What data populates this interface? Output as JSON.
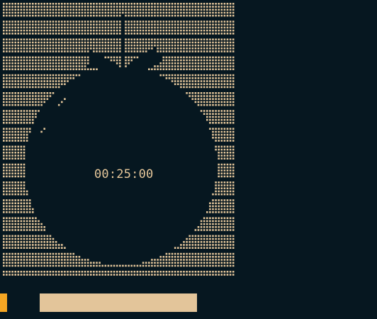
{
  "timer": {
    "remaining": "00:25:00",
    "progress_fraction": 1.0
  },
  "art": {
    "name": "tomato-icon"
  },
  "colors": {
    "background": "#061720",
    "dots": "#e3c59a",
    "timer_text": "#e6c79a",
    "status_indicator": "#f5a623",
    "progress_fill": "#e3c59a"
  }
}
